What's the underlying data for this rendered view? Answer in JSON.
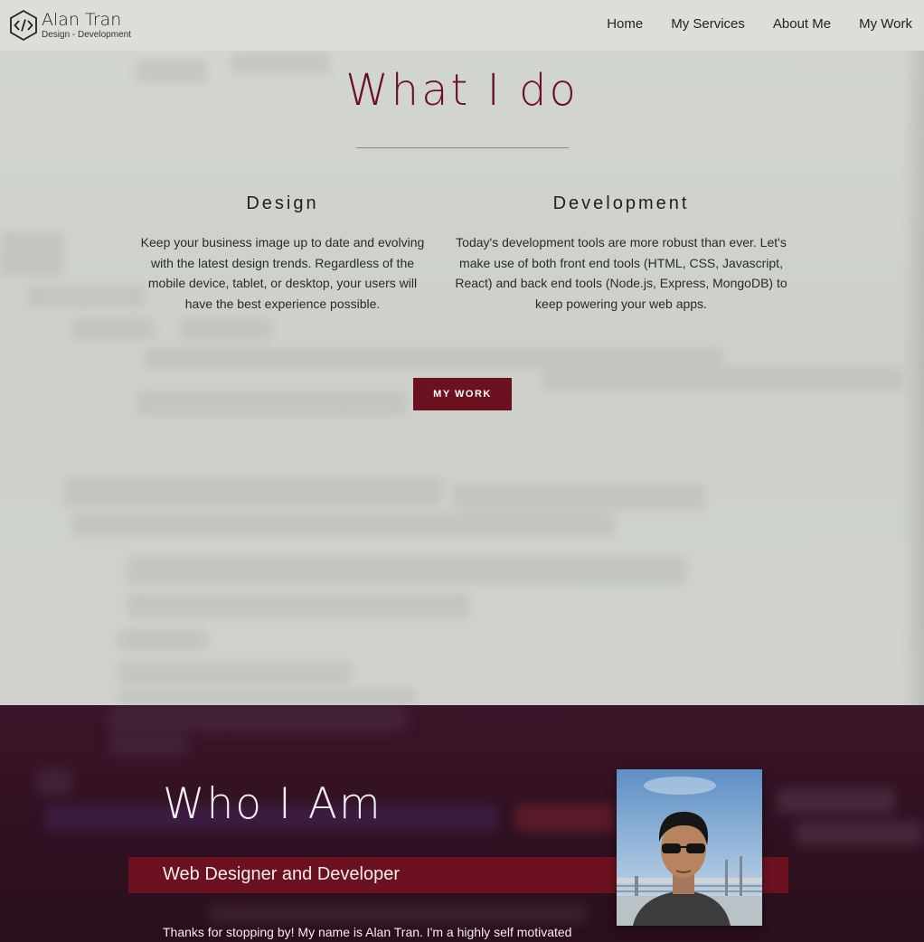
{
  "brand": {
    "name": "Alan Tran",
    "tagline": "Design - Development"
  },
  "nav": {
    "items": [
      {
        "label": "Home"
      },
      {
        "label": "My Services"
      },
      {
        "label": "About Me"
      },
      {
        "label": "My Work"
      }
    ]
  },
  "services": {
    "title": "What I do",
    "design": {
      "heading": "Design",
      "text": "Keep your business image up to date and evolving with the latest design trends. Regardless of the mobile device, tablet, or desktop, your users will have the best experience possible."
    },
    "development": {
      "heading": "Development",
      "text": "Today's development tools are more robust than ever. Let's make use of both front end tools (HTML, CSS, Javascript, React) and back end tools (Node.js, Express, MongoDB) to keep powering your web apps."
    },
    "button_label": "MY WORK"
  },
  "about": {
    "title": "Who I Am",
    "subtitle": "Web Designer and Developer",
    "intro": "Thanks for stopping by! My name is Alan Tran. I'm a highly self motivated"
  },
  "colors": {
    "accent": "#6b1120",
    "about_bg": "#2f1020",
    "services_bg": "#cfd2cc",
    "header_bg": "#dcdfd9"
  },
  "icons": {
    "logo": "code-hexagon-icon",
    "photo": "profile-photo"
  }
}
